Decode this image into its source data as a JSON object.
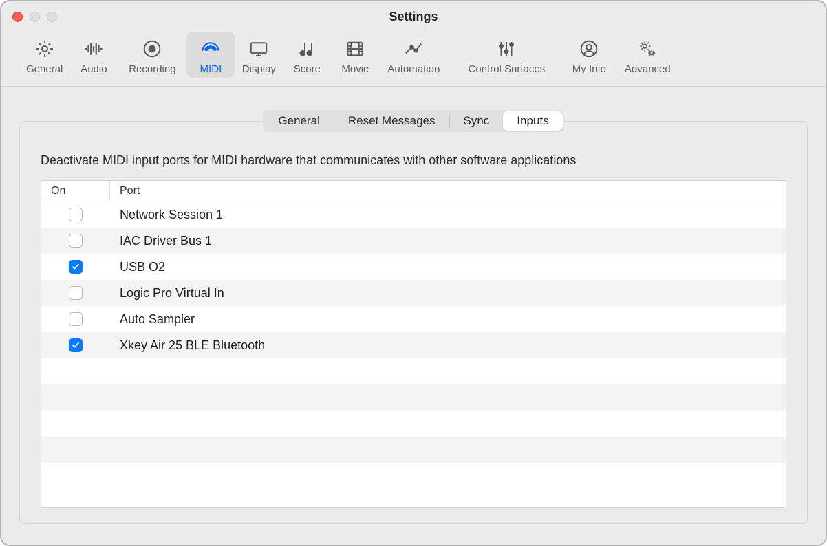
{
  "window": {
    "title": "Settings"
  },
  "toolbar": {
    "items": [
      {
        "id": "general",
        "label": "General"
      },
      {
        "id": "audio",
        "label": "Audio"
      },
      {
        "id": "recording",
        "label": "Recording"
      },
      {
        "id": "midi",
        "label": "MIDI",
        "active": true
      },
      {
        "id": "display",
        "label": "Display"
      },
      {
        "id": "score",
        "label": "Score"
      },
      {
        "id": "movie",
        "label": "Movie"
      },
      {
        "id": "automation",
        "label": "Automation"
      },
      {
        "id": "controlsurfaces",
        "label": "Control Surfaces"
      },
      {
        "id": "myinfo",
        "label": "My Info"
      },
      {
        "id": "advanced",
        "label": "Advanced"
      }
    ]
  },
  "subtabs": {
    "items": [
      {
        "id": "general",
        "label": "General"
      },
      {
        "id": "reset",
        "label": "Reset Messages"
      },
      {
        "id": "sync",
        "label": "Sync"
      },
      {
        "id": "inputs",
        "label": "Inputs",
        "selected": true
      }
    ]
  },
  "instruction": "Deactivate MIDI input ports for MIDI hardware that communicates with other software applications",
  "table": {
    "headers": {
      "on": "On",
      "port": "Port"
    },
    "rows": [
      {
        "on": false,
        "port": "Network Session 1"
      },
      {
        "on": false,
        "port": "IAC Driver Bus 1"
      },
      {
        "on": true,
        "port": "USB O2"
      },
      {
        "on": false,
        "port": "Logic Pro Virtual In"
      },
      {
        "on": false,
        "port": "Auto Sampler"
      },
      {
        "on": true,
        "port": "Xkey Air 25 BLE Bluetooth"
      }
    ],
    "blank_rows": 5
  },
  "colors": {
    "accent": "#0a7aff"
  }
}
